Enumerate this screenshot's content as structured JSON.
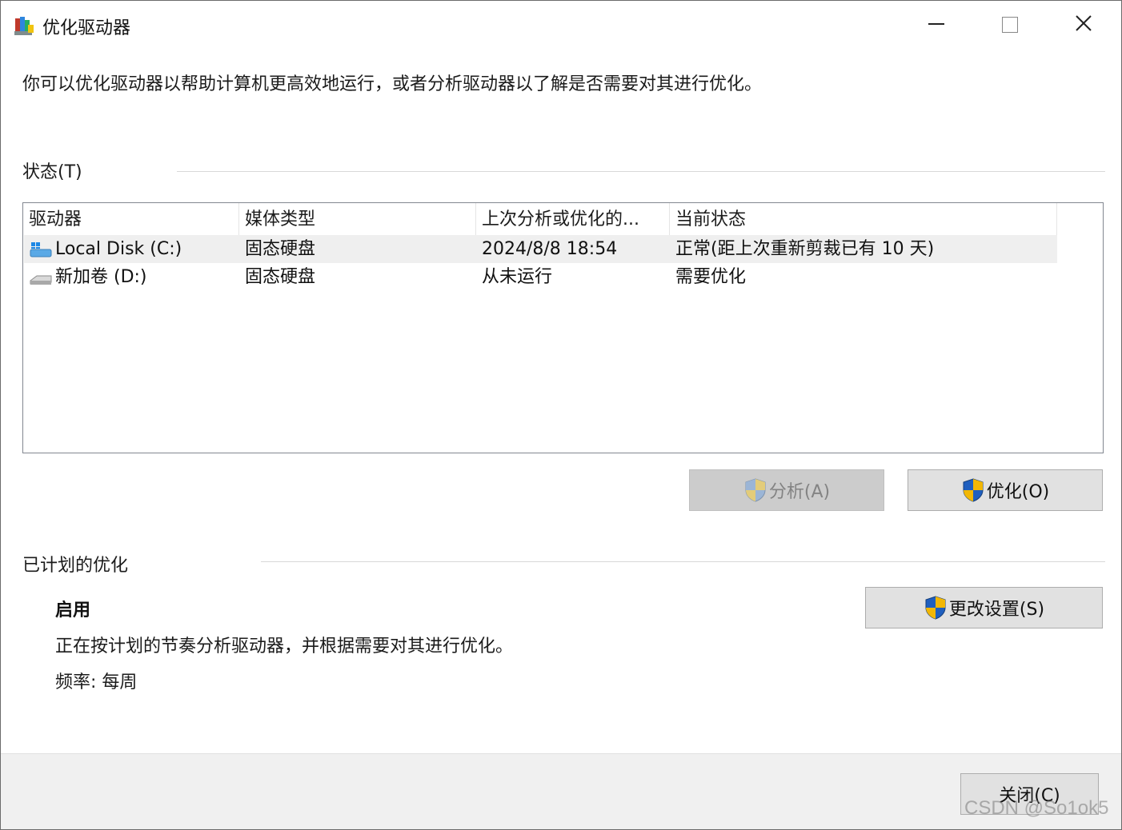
{
  "window": {
    "title": "优化驱动器",
    "icon": "defrag-app-icon",
    "controls": {
      "minimize": "minimize-icon",
      "maximize": "maximize-icon",
      "close": "close-icon"
    }
  },
  "intro_text": "你可以优化驱动器以帮助计算机更高效地运行，或者分析驱动器以了解是否需要对其进行优化。",
  "status_section": {
    "label": "状态(T)",
    "columns": [
      "驱动器",
      "媒体类型",
      "上次分析或优化的...",
      "当前状态"
    ],
    "rows": [
      {
        "drive": "Local Disk (C:)",
        "icon": "system-drive-icon",
        "media": "固态硬盘",
        "last": "2024/8/8 18:54",
        "status": "正常(距上次重新剪裁已有 10 天)",
        "selected": true
      },
      {
        "drive": "新加卷 (D:)",
        "icon": "drive-icon",
        "media": "固态硬盘",
        "last": "从未运行",
        "status": "需要优化",
        "selected": false
      }
    ]
  },
  "buttons": {
    "analyze": "分析(A)",
    "optimize": "优化(O)",
    "change_settings": "更改设置(S)",
    "close": "关闭(C)"
  },
  "scheduled_section": {
    "label": "已计划的优化",
    "state": "启用",
    "description": "正在按计划的节奏分析驱动器，并根据需要对其进行优化。",
    "frequency": "频率: 每周"
  },
  "watermark": "CSDN @So1ok5",
  "colors": {
    "shield_blue": "#1f5fbf",
    "shield_yellow": "#f2b705",
    "selected_row": "#efefef",
    "button_bg": "#e1e1e1",
    "footer_bg": "#f0f0f0"
  }
}
